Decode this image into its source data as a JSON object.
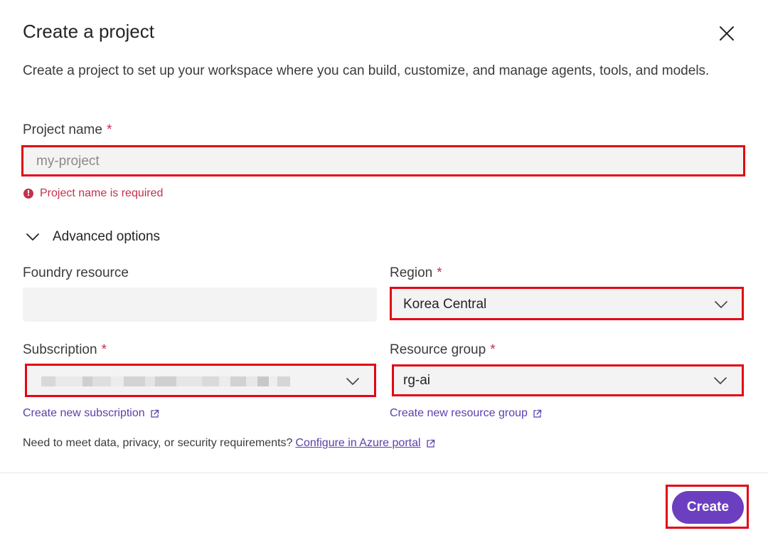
{
  "dialog": {
    "title": "Create a project",
    "description": "Create a project to set up your workspace where you can build, customize, and manage agents, tools, and models."
  },
  "project_name": {
    "label": "Project name",
    "required_mark": "*",
    "placeholder": "my-project",
    "value": "",
    "error": "Project name is required"
  },
  "advanced": {
    "label": "Advanced options",
    "expanded": true
  },
  "foundry_resource": {
    "label": "Foundry resource",
    "value": ""
  },
  "region": {
    "label": "Region",
    "required_mark": "*",
    "value": "Korea Central"
  },
  "subscription": {
    "label": "Subscription",
    "required_mark": "*",
    "value_redacted": true,
    "create_link": "Create new subscription"
  },
  "resource_group": {
    "label": "Resource group",
    "required_mark": "*",
    "value": "rg-ai",
    "create_link": "Create new resource group"
  },
  "footnote": {
    "text": "Need to meet data, privacy, or security requirements?",
    "link": "Configure in Azure portal"
  },
  "footer": {
    "create_label": "Create"
  },
  "colors": {
    "accent": "#6b3fbf",
    "link": "#5b3fad",
    "error": "#c4314b",
    "highlight_box": "#e30613",
    "field_bg": "#f3f3f3"
  },
  "icons": [
    "close-icon",
    "error-icon",
    "chevron-down-icon",
    "external-link-icon"
  ]
}
